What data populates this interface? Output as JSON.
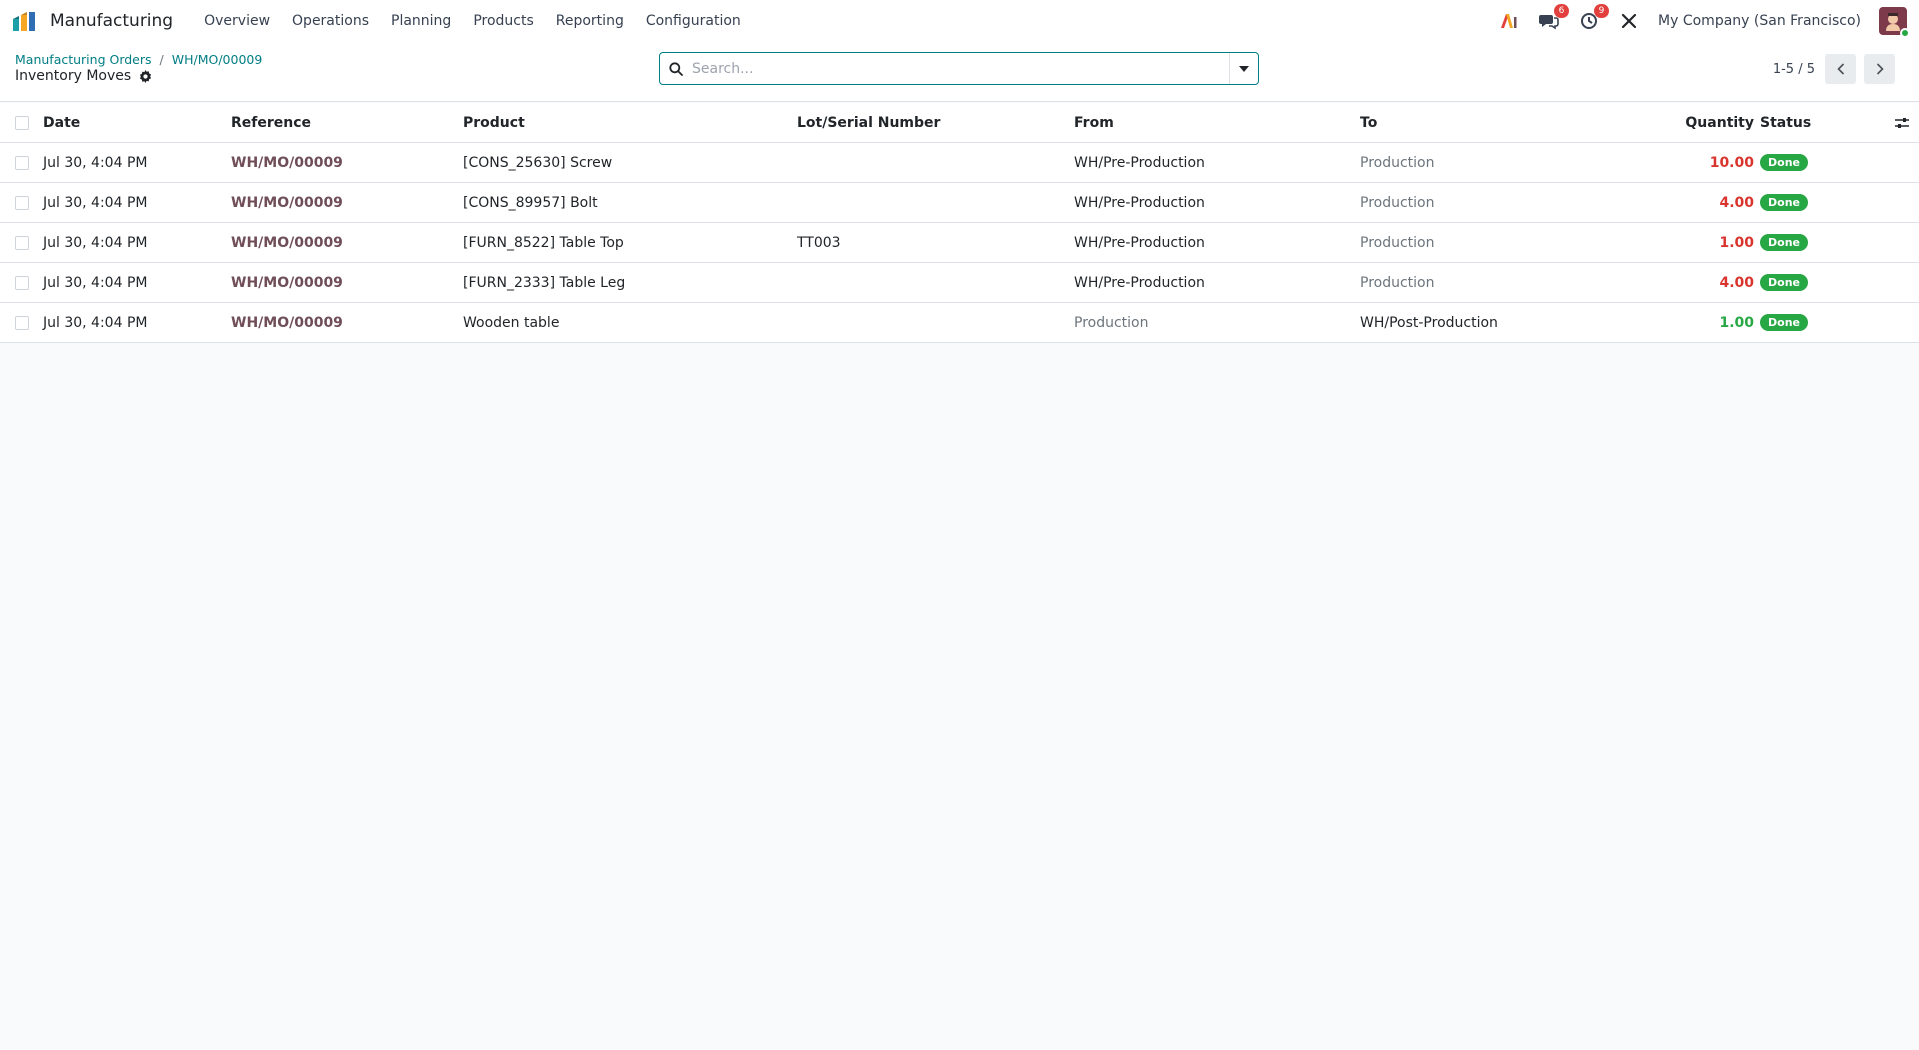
{
  "app": {
    "name": "Manufacturing",
    "icon": "manufacturing-app-icon"
  },
  "menu": [
    {
      "label": "Overview"
    },
    {
      "label": "Operations"
    },
    {
      "label": "Planning"
    },
    {
      "label": "Products"
    },
    {
      "label": "Reporting"
    },
    {
      "label": "Configuration"
    }
  ],
  "systray": {
    "messages_count": "6",
    "activities_count": "9",
    "company": "My Company (San Francisco)"
  },
  "breadcrumb": [
    {
      "label": "Manufacturing Orders"
    },
    {
      "label": "WH/MO/00009"
    }
  ],
  "page_title": "Inventory Moves",
  "search": {
    "placeholder": "Search..."
  },
  "pager": {
    "value": "1-5 / 5"
  },
  "colors": {
    "accent": "#017e84",
    "reference": "#6f4e58",
    "qty_negative": "#d9352e",
    "qty_positive": "#28a745",
    "status_done": "#28a745"
  },
  "table": {
    "columns": {
      "date": "Date",
      "reference": "Reference",
      "product": "Product",
      "lot": "Lot/Serial Number",
      "from": "From",
      "to": "To",
      "quantity": "Quantity",
      "status": "Status"
    },
    "rows": [
      {
        "date": "Jul 30, 4:04 PM",
        "reference": "WH/MO/00009",
        "product": "[CONS_25630] Screw",
        "lot": "",
        "from": "WH/Pre-Production",
        "to": "Production",
        "quantity": "10.00",
        "status": "Done"
      },
      {
        "date": "Jul 30, 4:04 PM",
        "reference": "WH/MO/00009",
        "product": "[CONS_89957] Bolt",
        "lot": "",
        "from": "WH/Pre-Production",
        "to": "Production",
        "quantity": "4.00",
        "status": "Done"
      },
      {
        "date": "Jul 30, 4:04 PM",
        "reference": "WH/MO/00009",
        "product": "[FURN_8522] Table Top",
        "lot": "TT003",
        "from": "WH/Pre-Production",
        "to": "Production",
        "quantity": "1.00",
        "status": "Done"
      },
      {
        "date": "Jul 30, 4:04 PM",
        "reference": "WH/MO/00009",
        "product": "[FURN_2333] Table Leg",
        "lot": "",
        "from": "WH/Pre-Production",
        "to": "Production",
        "quantity": "4.00",
        "status": "Done"
      },
      {
        "date": "Jul 30, 4:04 PM",
        "reference": "WH/MO/00009",
        "product": "Wooden table",
        "lot": "",
        "from": "Production",
        "to": "WH/Post-Production",
        "quantity": "1.00",
        "status": "Done"
      }
    ]
  }
}
